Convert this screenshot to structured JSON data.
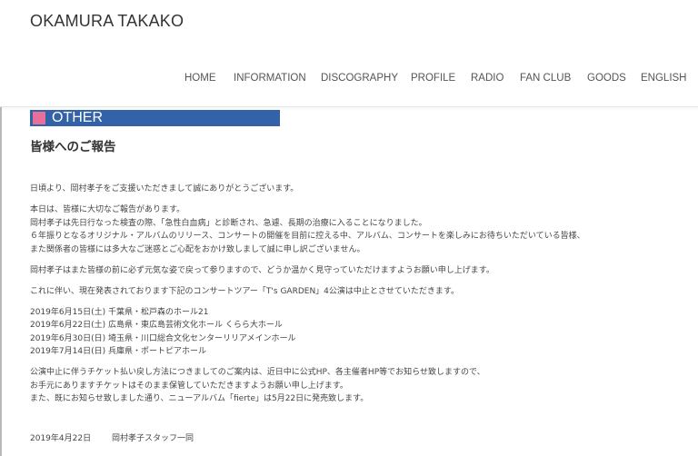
{
  "site": {
    "title": "OKAMURA TAKAKO"
  },
  "nav": {
    "items": [
      {
        "label": "HOME"
      },
      {
        "label": "INFORMATION"
      },
      {
        "label": "DISCOGRAPHY"
      },
      {
        "label": "PROFILE"
      },
      {
        "label": "RADIO"
      },
      {
        "label": "FAN CLUB"
      },
      {
        "label": "GOODS"
      },
      {
        "label": "ENGLISH"
      }
    ]
  },
  "section": {
    "label": "OTHER",
    "bar_color": "#3462a8",
    "swatch_color": "#e76f9c"
  },
  "post": {
    "title": "皆様へのご報告",
    "paragraphs": [
      {
        "lines": [
          "日頃より、岡村孝子をご支援いただきまして誠にありがとうございます。"
        ]
      },
      {
        "lines": [
          "本日は、皆様に大切なご報告があります。",
          "岡村孝子は先日行なった検査の際、「急性白血病」と診断され、急遽、長期の治療に入ることになりました。",
          "６年振りとなるオリジナル・アルバムのリリース、コンサートの開催を目前に控える中、アルバム、コンサートを楽しみにお待ちいただいている皆様、",
          "また関係者の皆様には多大なご迷惑とご心配をおかけ致しまして誠に申し訳ございません。"
        ]
      },
      {
        "lines": [
          "岡村孝子はまた皆様の前に必ず元気な姿で戻って参りますので、どうか温かく見守っていただけますようお願い申し上げます。"
        ]
      },
      {
        "lines": [
          "これに伴い、現在発表されております下記のコンサートツアー「T's GARDEN」4公演は中止とさせていただきます。"
        ]
      },
      {
        "lines": [
          "2019年6月15日(土) 千葉県・松戸森のホール21",
          "2019年6月22日(土) 広島県・東広島芸術文化ホール くらら大ホール",
          "2019年6月30日(日) 埼玉県・川口総合文化センターリリアメインホール",
          "2019年7月14日(日) 兵庫県・ポートピアホール"
        ]
      },
      {
        "lines": [
          "公演中止に伴うチケット払い戻し方法につきましてのご案内は、近日中に公式HP、各主催者HP等でお知らせ致しますので、",
          "お手元にありますチケットはそのまま保管していただきますようお願い申し上げます。",
          "また、既にお知らせ致しました通り、ニューアルバム「fierte」は5月22日に発売致します。"
        ]
      }
    ],
    "signature_date": "2019年4月22日",
    "signature_name": "岡村孝子スタッフ一同"
  }
}
